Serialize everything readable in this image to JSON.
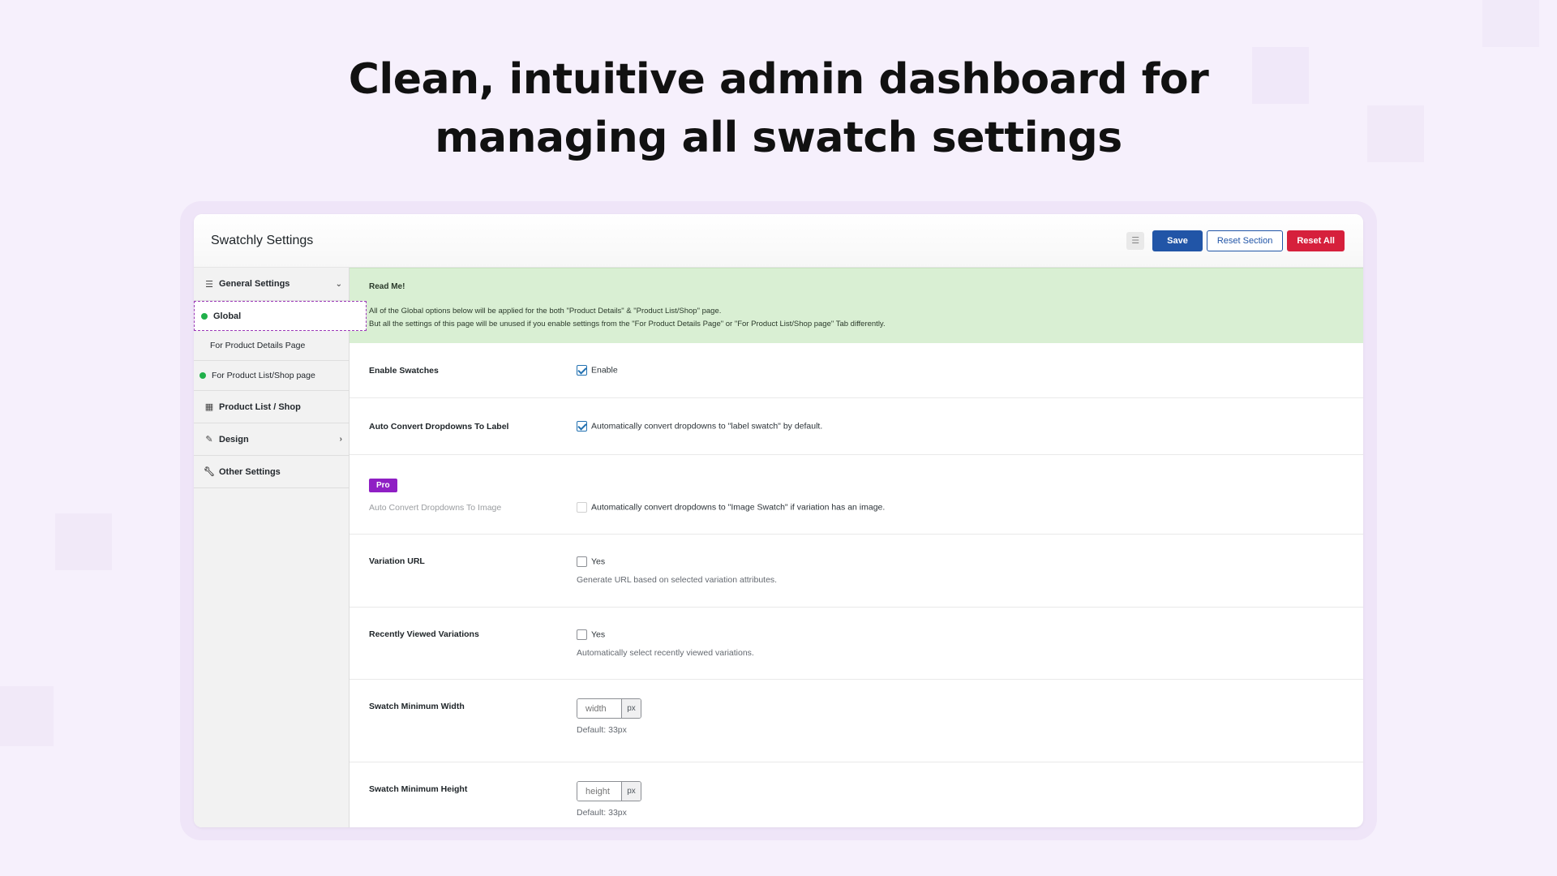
{
  "headline": {
    "line1": "Clean, intuitive admin dashboard for",
    "line2": "managing all swatch settings"
  },
  "app": {
    "title": "Swatchly Settings",
    "buttons": {
      "save": "Save",
      "reset_section": "Reset Section",
      "reset_all": "Reset All"
    },
    "colors": {
      "primary": "#2155a7",
      "danger": "#d6203c",
      "pro": "#8f1fc4",
      "notice": "#d9efd3",
      "active_dot": "#20b04a"
    }
  },
  "sidebar": {
    "general": "General Settings",
    "sub": [
      "Global",
      "For Product Details Page",
      "For Product List/Shop page"
    ],
    "product_list": "Product List / Shop",
    "design": "Design",
    "other": "Other Settings"
  },
  "notice": {
    "title": "Read Me!",
    "line1": "All of the Global options below will be applied for the both \"Product Details\" & \"Product List/Shop\" page.",
    "line2": "But all the settings of this page will be unused if you enable settings from the \"For Product Details Page\" or \"For Product List/Shop page\" Tab differently."
  },
  "settings": {
    "enable_swatches": {
      "label": "Enable Swatches",
      "option": "Enable",
      "checked": true
    },
    "auto_label": {
      "label": "Auto Convert Dropdowns To Label",
      "option": "Automatically convert dropdowns to \"label swatch\" by default.",
      "checked": true
    },
    "auto_image": {
      "badge": "Pro",
      "label": "Auto Convert Dropdowns To Image",
      "option": "Automatically convert dropdowns to \"Image Swatch\" if variation has an image.",
      "checked": false
    },
    "variation_url": {
      "label": "Variation URL",
      "option": "Yes",
      "desc": "Generate URL based on selected variation attributes.",
      "checked": false
    },
    "recent": {
      "label": "Recently Viewed Variations",
      "option": "Yes",
      "desc": "Automatically select recently viewed variations.",
      "checked": false
    },
    "min_width": {
      "label": "Swatch Minimum Width",
      "placeholder": "width",
      "unit": "px",
      "desc": "Default: 33px"
    },
    "min_height": {
      "label": "Swatch Minimum Height",
      "placeholder": "height",
      "unit": "px",
      "desc": "Default: 33px"
    }
  }
}
